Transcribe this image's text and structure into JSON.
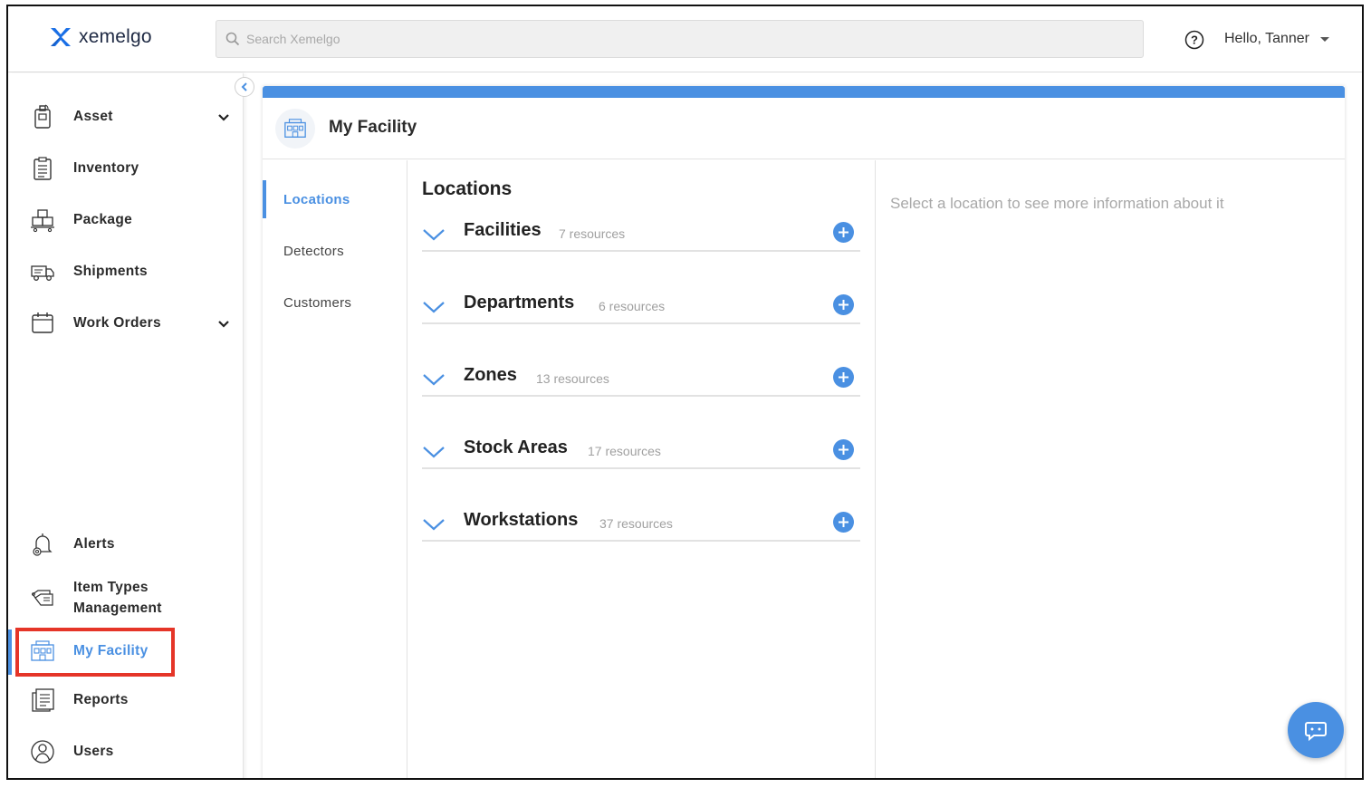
{
  "brand": {
    "name": "xemelgo",
    "accent": "#4a90e2",
    "logo_color": "#1a6fe6"
  },
  "header": {
    "search_placeholder": "Search Xemelgo",
    "greeting": "Hello, Tanner",
    "help_icon": "question-circle-icon"
  },
  "sidebar": {
    "items": [
      {
        "label": "Asset",
        "icon": "asset-tag-icon",
        "has_submenu": true
      },
      {
        "label": "Inventory",
        "icon": "clipboard-icon",
        "has_submenu": false
      },
      {
        "label": "Package",
        "icon": "boxes-icon",
        "has_submenu": false
      },
      {
        "label": "Shipments",
        "icon": "truck-icon",
        "has_submenu": false
      },
      {
        "label": "Work Orders",
        "icon": "calendar-icon",
        "has_submenu": true
      }
    ],
    "bottom_items": [
      {
        "label": "Alerts",
        "icon": "bell-gear-icon"
      },
      {
        "label_line1": "Item Types",
        "label_line2": "Management",
        "icon": "tags-icon"
      },
      {
        "label": "My Facility",
        "icon": "facility-icon",
        "active": true
      },
      {
        "label": "Reports",
        "icon": "reports-icon"
      },
      {
        "label": "Users",
        "icon": "user-circle-icon"
      }
    ]
  },
  "page": {
    "title": "My Facility",
    "tabs": [
      {
        "label": "Locations",
        "active": true
      },
      {
        "label": "Detectors",
        "active": false
      },
      {
        "label": "Customers",
        "active": false
      }
    ],
    "list_title": "Locations",
    "groups": [
      {
        "name": "Facilities",
        "count": "7 resources"
      },
      {
        "name": "Departments",
        "count": "6 resources"
      },
      {
        "name": "Zones",
        "count": "13 resources"
      },
      {
        "name": "Stock Areas",
        "count": "17 resources"
      },
      {
        "name": "Workstations",
        "count": "37 resources"
      }
    ],
    "detail_hint": "Select a location to see more information about it"
  }
}
